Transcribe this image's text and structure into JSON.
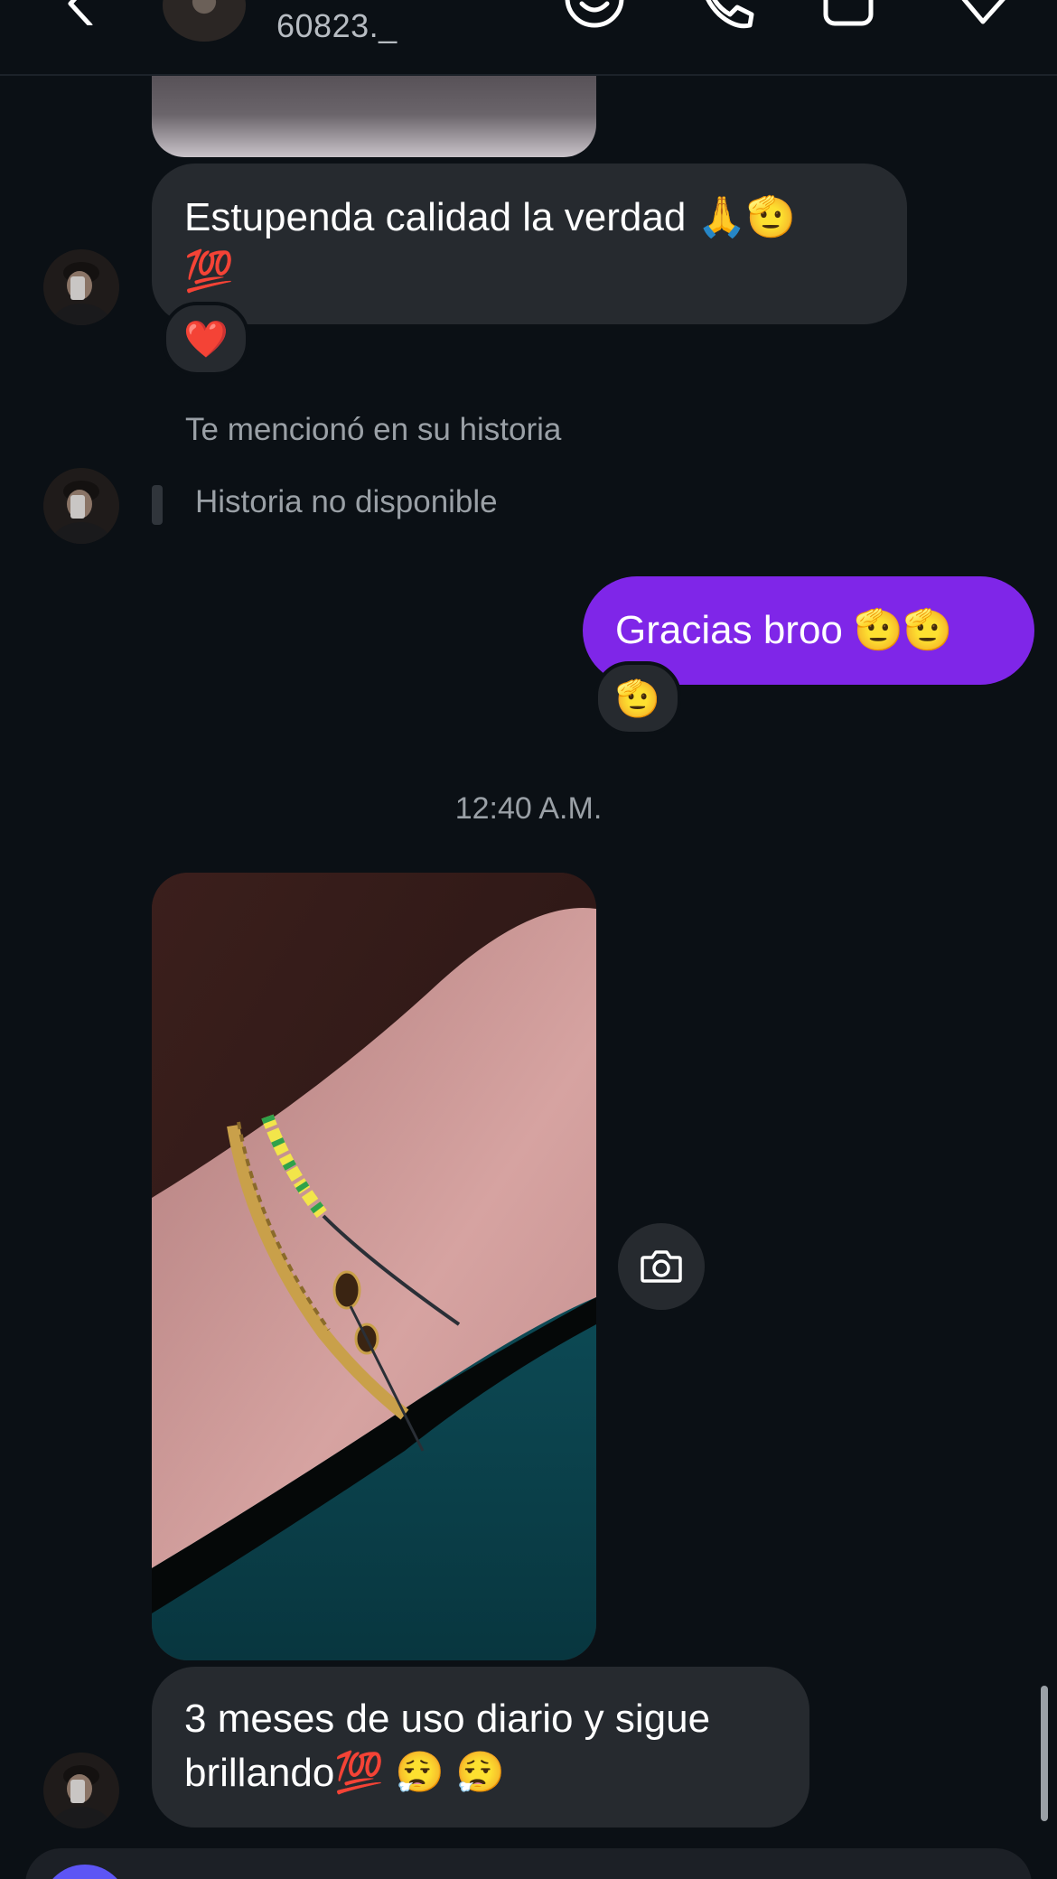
{
  "header": {
    "username": "60823._"
  },
  "messages": {
    "msg1": {
      "text": "Estupenda calidad la verdad 🙏🫡\n💯",
      "reaction": "❤️"
    },
    "story": {
      "mention": "Te mencionó en su historia",
      "unavailable": "Historia no disponible"
    },
    "msg2": {
      "text": "Gracias broo 🫡🫡",
      "reaction": "🫡"
    },
    "timestamp": "12:40 A.M.",
    "msg3": {
      "text": "3 meses de uso diario y sigue\nbrillando💯 😮‍💨 😮‍💨"
    }
  },
  "colors": {
    "background": "#0b1015",
    "incoming_bubble": "#262a2f",
    "outgoing_bubble": "#7f26e8",
    "muted_text": "#9aa0a6"
  }
}
